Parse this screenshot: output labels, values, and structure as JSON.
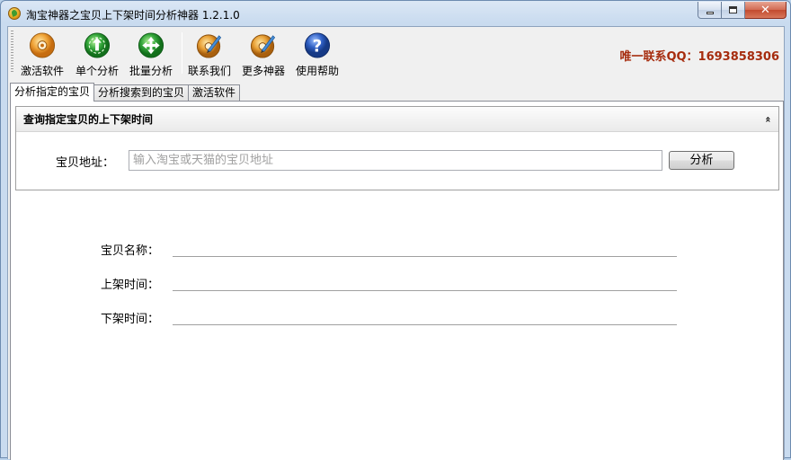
{
  "window": {
    "title": "淘宝神器之宝贝上下架时间分析神器 1.2.1.0",
    "controls": {
      "minimize": "",
      "maximize": "",
      "close": "✕"
    }
  },
  "toolbar": {
    "items": [
      {
        "label": "激活软件",
        "icon": "activate-disc-icon"
      },
      {
        "label": "单个分析",
        "icon": "single-analysis-icon"
      },
      {
        "label": "批量分析",
        "icon": "batch-analysis-icon"
      },
      {
        "label": "联系我们",
        "icon": "contact-disc-icon"
      },
      {
        "label": "更多神器",
        "icon": "more-tools-disc-icon"
      },
      {
        "label": "使用帮助",
        "icon": "help-icon"
      }
    ],
    "contact": "唯一联系QQ：1693858306"
  },
  "tabs": [
    {
      "label": "分析指定的宝贝",
      "active": true
    },
    {
      "label": "分析搜索到的宝贝",
      "active": false
    },
    {
      "label": "激活软件",
      "active": false
    }
  ],
  "query_group": {
    "title": "查询指定宝贝的上下架时间",
    "collapse_glyph": "»",
    "address_label": "宝贝地址：",
    "address_value": "",
    "address_placeholder": "输入淘宝或天猫的宝贝地址",
    "analyze_label": "分析"
  },
  "results": {
    "name_label": "宝贝名称：",
    "name_value": "",
    "list_time_label": "上架时间：",
    "list_time_value": "",
    "delist_time_label": "下架时间：",
    "delist_time_value": ""
  },
  "colors": {
    "contact_text": "#a62c0e",
    "title_bar": "#c9dbef",
    "close_button": "#c24a2f"
  }
}
